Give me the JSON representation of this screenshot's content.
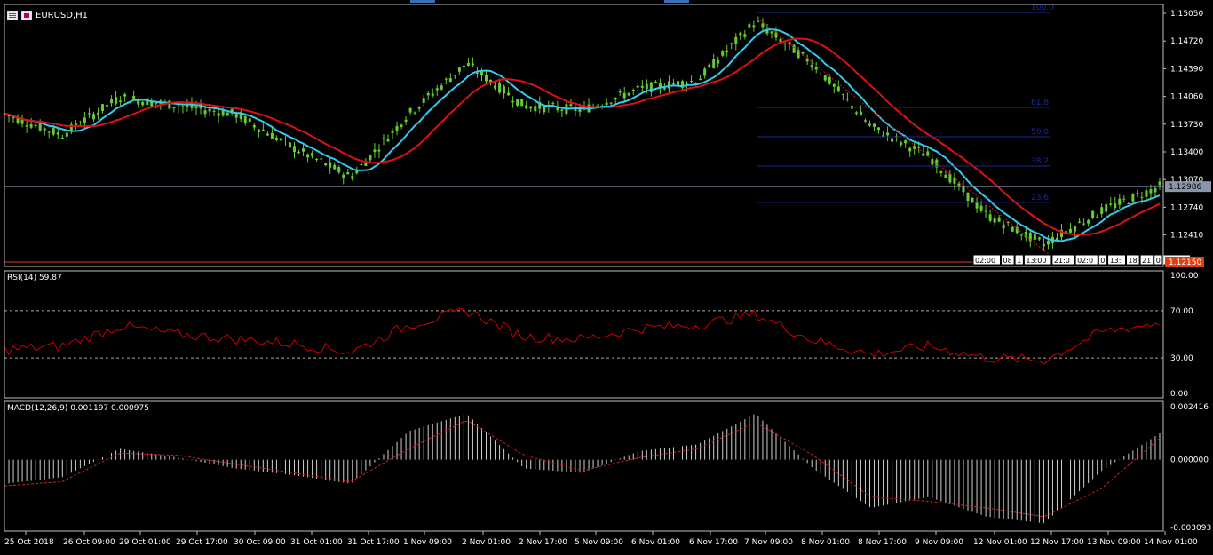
{
  "window": {
    "symbol_label": "EURUSD,H1",
    "icons": [
      "chart-list-icon",
      "chart-properties-icon"
    ]
  },
  "colors": {
    "background": "#000000",
    "candle_up": "#66cc33",
    "candle_down": "#66cc33",
    "ma_fast": "#33ccee",
    "ma_slow": "#dd1111",
    "fib": "#1a2a9a",
    "rsi_line": "#cc0000",
    "macd_signal": "#cc2222",
    "macd_hist": "#cfcfcf",
    "bid_line": "#7a8aa0",
    "price_label_bg": "#8a96a8",
    "alert_label_bg": "#e04010",
    "axis_text": "#ffffff",
    "panel_border": "#bfbfbf"
  },
  "price_panel": {
    "y_ticks": [
      "1.15050",
      "1.14720",
      "1.14390",
      "1.14060",
      "1.13730",
      "1.13400",
      "1.13070",
      "1.12740",
      "1.12410"
    ],
    "current_price_label": "1.12986",
    "alert_price_label": "1.12150",
    "fibonacci_levels": [
      "100.0",
      "61.8",
      "50.0",
      "38.2",
      "23.6"
    ],
    "time_badges": [
      "02:00",
      "08",
      "1",
      "13:00",
      "21:0",
      "02:0",
      "0",
      "13:",
      "18",
      "21",
      "0",
      "02:00"
    ]
  },
  "rsi_panel": {
    "label": "RSI(14) 59.87",
    "y_ticks": [
      "100.00",
      "70.00",
      "30.00",
      "0.00"
    ]
  },
  "macd_panel": {
    "label": "MACD(12,26,9) 0.001197 0.000975",
    "y_ticks": [
      "0.002416",
      "0.000000",
      "-0.003093"
    ]
  },
  "x_axis": {
    "labels": [
      "25 Oct 2018",
      "26 Oct 09:00",
      "29 Oct 01:00",
      "29 Oct 17:00",
      "30 Oct 09:00",
      "31 Oct 01:00",
      "31 Oct 17:00",
      "1 Nov 09:00",
      "2 Nov 01:00",
      "2 Nov 17:00",
      "5 Nov 09:00",
      "6 Nov 01:00",
      "6 Nov 17:00",
      "7 Nov 09:00",
      "8 Nov 01:00",
      "8 Nov 17:00",
      "9 Nov 09:00",
      "12 Nov 01:00",
      "12 Nov 17:00",
      "13 Nov 09:00",
      "14 Nov 01:00"
    ]
  },
  "chart_data": [
    {
      "type": "candlestick",
      "title": "EURUSD,H1",
      "ylim": [
        1.1215,
        1.1505
      ],
      "price_anchors": [
        [
          "25 Oct 2018",
          1.1385
        ],
        [
          "26 Oct 09:00",
          1.136
        ],
        [
          "29 Oct 01:00",
          1.1405
        ],
        [
          "29 Oct 17:00",
          1.1395
        ],
        [
          "30 Oct 09:00",
          1.1385
        ],
        [
          "31 Oct 01:00",
          1.1345
        ],
        [
          "31 Oct 17:00",
          1.131
        ],
        [
          "1 Nov 09:00",
          1.1385
        ],
        [
          "2 Nov 01:00",
          1.1445
        ],
        [
          "2 Nov 17:00",
          1.1395
        ],
        [
          "5 Nov 09:00",
          1.139
        ],
        [
          "6 Nov 01:00",
          1.1415
        ],
        [
          "6 Nov 17:00",
          1.1425
        ],
        [
          "7 Nov 09:00",
          1.1495
        ],
        [
          "8 Nov 01:00",
          1.1445
        ],
        [
          "8 Nov 17:00",
          1.137
        ],
        [
          "9 Nov 09:00",
          1.1335
        ],
        [
          "12 Nov 01:00",
          1.1265
        ],
        [
          "12 Nov 17:00",
          1.123
        ],
        [
          "13 Nov 09:00",
          1.127
        ],
        [
          "14 Nov 01:00",
          1.1299
        ]
      ],
      "moving_averages": [
        {
          "name": "MA fast",
          "color": "#33ccee"
        },
        {
          "name": "MA slow",
          "color": "#dd1111"
        }
      ],
      "fibonacci": {
        "levels": [
          100.0,
          61.8,
          50.0,
          38.2,
          23.6
        ],
        "from": 1.1505,
        "to": 1.1215
      },
      "bid": 1.12986,
      "alert": 1.1215
    },
    {
      "type": "line",
      "title": "RSI(14) 59.87",
      "ylim": [
        0,
        100
      ],
      "levels": [
        70,
        30
      ],
      "x": [
        "25 Oct 2018",
        "26 Oct 09:00",
        "29 Oct 01:00",
        "29 Oct 17:00",
        "30 Oct 09:00",
        "31 Oct 01:00",
        "31 Oct 17:00",
        "1 Nov 09:00",
        "2 Nov 01:00",
        "2 Nov 17:00",
        "5 Nov 09:00",
        "6 Nov 01:00",
        "6 Nov 17:00",
        "7 Nov 09:00",
        "8 Nov 01:00",
        "8 Nov 17:00",
        "9 Nov 09:00",
        "12 Nov 01:00",
        "12 Nov 17:00",
        "13 Nov 09:00",
        "14 Nov 01:00"
      ],
      "values": [
        37,
        40,
        57,
        50,
        46,
        42,
        35,
        58,
        70,
        48,
        46,
        55,
        58,
        67,
        45,
        33,
        40,
        30,
        28,
        52,
        60
      ]
    },
    {
      "type": "bar",
      "title": "MACD(12,26,9) 0.001197 0.000975",
      "ylim": [
        -0.003093,
        0.002416
      ],
      "x": [
        "25 Oct 2018",
        "26 Oct 09:00",
        "29 Oct 01:00",
        "29 Oct 17:00",
        "30 Oct 09:00",
        "31 Oct 01:00",
        "31 Oct 17:00",
        "1 Nov 09:00",
        "2 Nov 01:00",
        "2 Nov 17:00",
        "5 Nov 09:00",
        "6 Nov 01:00",
        "6 Nov 17:00",
        "7 Nov 09:00",
        "8 Nov 01:00",
        "8 Nov 17:00",
        "9 Nov 09:00",
        "12 Nov 01:00",
        "12 Nov 17:00",
        "13 Nov 09:00",
        "14 Nov 01:00"
      ],
      "macd": [
        -0.0011,
        -0.0008,
        0.0005,
        0.0001,
        -0.0004,
        -0.0007,
        -0.0011,
        0.0013,
        0.0021,
        -0.0004,
        -0.0006,
        0.0004,
        0.0007,
        0.0021,
        -0.0004,
        -0.0022,
        -0.0017,
        -0.0026,
        -0.0029,
        -0.0005,
        0.0012
      ],
      "signal": [
        -0.0012,
        -0.001,
        0.0003,
        0.0002,
        -0.0002,
        -0.0006,
        -0.001,
        0.0005,
        0.0018,
        0.0002,
        -0.0005,
        0.0001,
        0.0005,
        0.0017,
        0.0002,
        -0.0017,
        -0.0019,
        -0.0022,
        -0.0026,
        -0.0013,
        0.00098
      ]
    }
  ]
}
